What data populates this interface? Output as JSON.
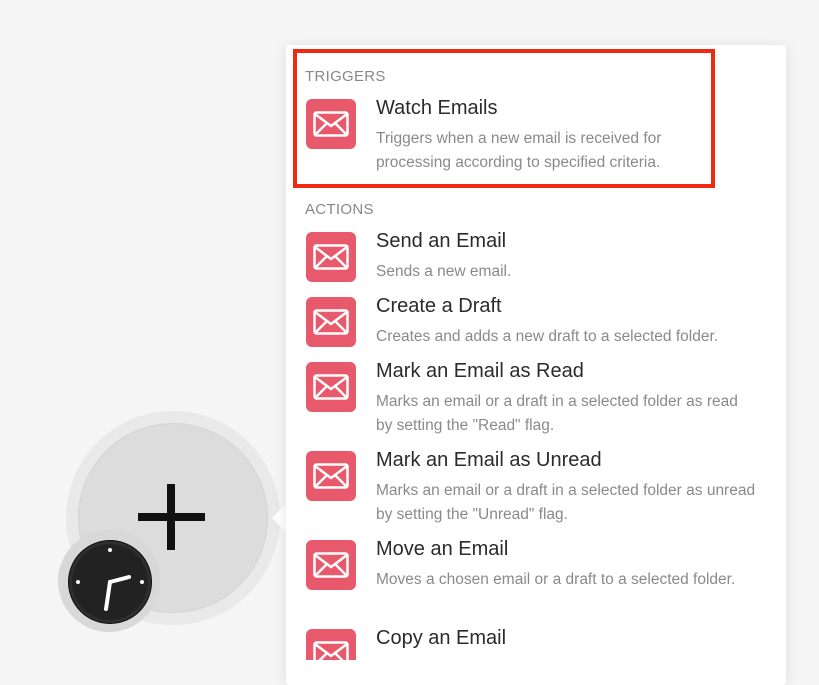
{
  "sections": {
    "triggers": {
      "label": "TRIGGERS",
      "items": [
        {
          "title": "Watch Emails",
          "description": "Triggers when a new email is received for processing according to specified criteria."
        }
      ]
    },
    "actions": {
      "label": "ACTIONS",
      "items": [
        {
          "title": "Send an Email",
          "description": "Sends a new email."
        },
        {
          "title": "Create a Draft",
          "description": "Creates and adds a new draft to a selected folder."
        },
        {
          "title": "Mark an Email as Read",
          "description": "Marks an email or a draft in a selected folder as read by setting the \"Read\" flag."
        },
        {
          "title": "Mark an Email as Unread",
          "description": "Marks an email or a draft in a selected folder as unread by setting the \"Unread\" flag."
        },
        {
          "title": "Move an Email",
          "description": "Moves a chosen email or a draft to a selected folder."
        },
        {
          "title": "Copy an Email",
          "description": ""
        }
      ]
    }
  },
  "icons": {
    "module_icon": "email-envelope-icon",
    "add_icon": "plus-icon",
    "schedule_icon": "clock-icon"
  },
  "colors": {
    "module_icon_bg": "#e85a6b",
    "highlight_border": "#ee2a12"
  }
}
